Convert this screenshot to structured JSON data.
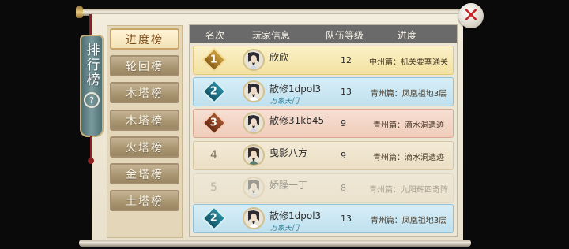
{
  "banner": {
    "title": "排行榜",
    "help_glyph": "?"
  },
  "close_glyph": "✕",
  "tabs": [
    {
      "label": "进度榜",
      "active": true
    },
    {
      "label": "轮回榜",
      "active": false
    },
    {
      "label": "木塔榜",
      "active": false
    },
    {
      "label": "木塔榜",
      "active": false
    },
    {
      "label": "火塔榜",
      "active": false
    },
    {
      "label": "金塔榜",
      "active": false
    },
    {
      "label": "土塔榜",
      "active": false
    }
  ],
  "table": {
    "headers": {
      "rank": "名次",
      "player": "玩家信息",
      "level": "队伍等级",
      "progress": "进度"
    },
    "rows": [
      {
        "rank": "1",
        "name": "欣欣",
        "tag": "",
        "level": "12",
        "progress": "中州篇：机关要塞通关",
        "style": "gold"
      },
      {
        "rank": "2",
        "name": "散修1dpol3",
        "tag": "万象天门",
        "level": "13",
        "progress": "青州篇：凤凰祖地3层",
        "style": "blue"
      },
      {
        "rank": "3",
        "name": "散修31kb45",
        "tag": "",
        "level": "9",
        "progress": "青州篇：滴水洞遗迹",
        "style": "copper"
      },
      {
        "rank": "4",
        "name": "曳影八方",
        "tag": "",
        "level": "9",
        "progress": "青州篇：滴水洞遗迹",
        "style": "plain"
      },
      {
        "rank": "5",
        "name": "娇躁一丁",
        "tag": "",
        "level": "8",
        "progress": "青州篇：九阳辉四奇阵",
        "style": "faded"
      },
      {
        "rank": "2",
        "name": "散修1dpol3",
        "tag": "万象天门",
        "level": "13",
        "progress": "青州篇：凤凰祖地3层",
        "style": "blue"
      }
    ]
  }
}
